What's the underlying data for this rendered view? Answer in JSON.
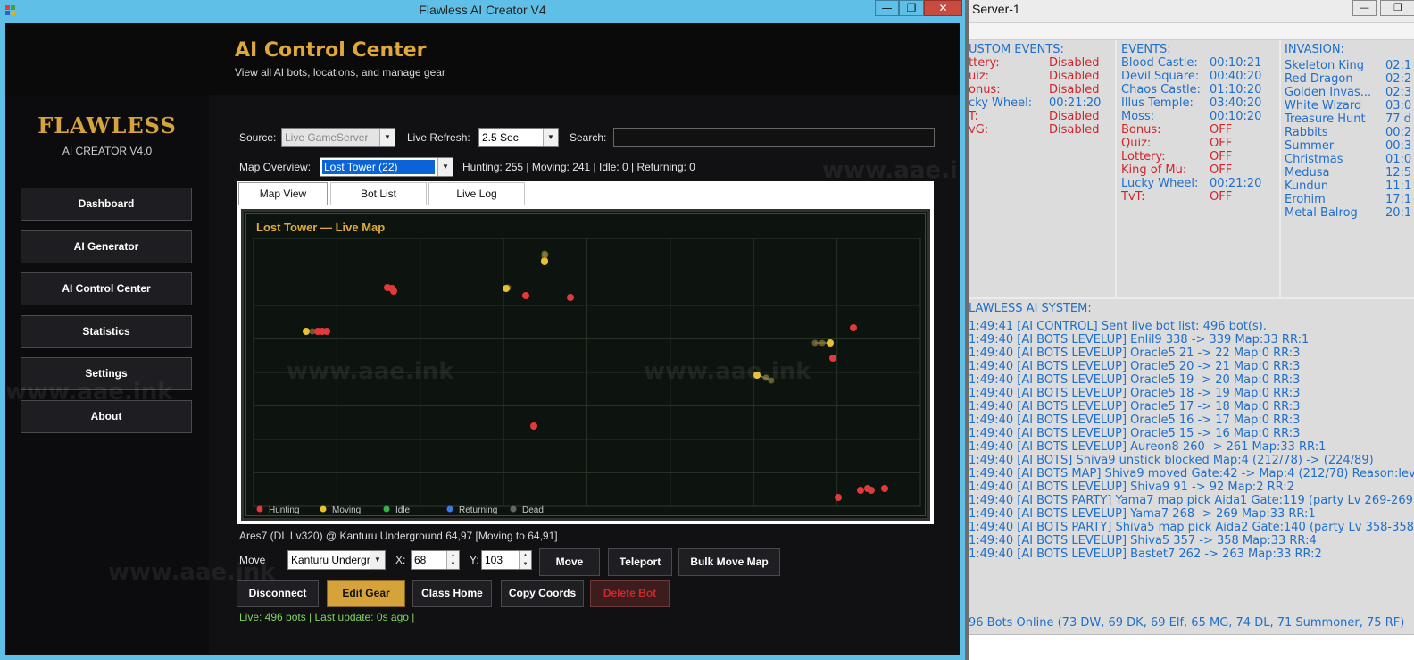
{
  "main_window": {
    "title": "Flawless AI Creator V4",
    "minimize": "—",
    "maximize": "❐",
    "close": "✕"
  },
  "sidebar": {
    "logo": "FLAWLESS",
    "logo_sub": "AI CREATOR V4.0",
    "items": [
      {
        "label": "Dashboard"
      },
      {
        "label": "AI Generator"
      },
      {
        "label": "AI Control Center"
      },
      {
        "label": "Statistics"
      },
      {
        "label": "Settings"
      },
      {
        "label": "About"
      }
    ]
  },
  "header": {
    "title": "AI Control Center",
    "subtitle": "View all AI bots, locations, and manage gear"
  },
  "filters": {
    "source_label": "Source:",
    "source_value": "Live GameServer",
    "refresh_label": "Live Refresh:",
    "refresh_value": "2.5 Sec",
    "search_label": "Search:",
    "map_label": "Map Overview:",
    "map_value": "Lost Tower (22)",
    "map_stats": "Hunting: 255 | Moving: 241 | Idle: 0 | Returning: 0"
  },
  "tabs": [
    {
      "label": "Map View"
    },
    {
      "label": "Bot List"
    },
    {
      "label": "Live Log"
    }
  ],
  "map": {
    "title": "Lost Tower — Live Map",
    "legend": [
      {
        "label": "Hunting",
        "color": "#e03a3a"
      },
      {
        "label": "Moving",
        "color": "#e8c030"
      },
      {
        "label": "Idle",
        "color": "#3ab04a"
      },
      {
        "label": "Returning",
        "color": "#3a7be0"
      },
      {
        "label": "Dead",
        "color": "#666666"
      }
    ],
    "colors": {
      "hunting": "#e03a3a",
      "moving": "#e8c030",
      "trail": "#8a7a3a"
    }
  },
  "selection": {
    "status": "Ares7 (DL Lv320) @ Kanturu Underground 64,97 [Moving to 64,91]",
    "move_label": "Move",
    "move_map": "Kanturu Undergr",
    "x_label": "X:",
    "x_value": "68",
    "y_label": "Y:",
    "y_value": "103"
  },
  "actions": {
    "move": "Move",
    "teleport": "Teleport",
    "bulk_move": "Bulk Move Map",
    "disconnect": "Disconnect",
    "edit_gear": "Edit Gear",
    "class_home": "Class Home",
    "copy_coords": "Copy Coords",
    "delete_bot": "Delete Bot"
  },
  "live_status": "Live: 496 bots | Last update: 0s ago |",
  "watermark": "www.aae.ink",
  "server_window": {
    "title": "Server-1",
    "custom_events": {
      "header": "USTOM EVENTS:",
      "rows": [
        {
          "name": "ttery:",
          "status": "Disabled",
          "kind": "red"
        },
        {
          "name": "uiz:",
          "status": "Disabled",
          "kind": "red"
        },
        {
          "name": "onus:",
          "status": "Disabled",
          "kind": "red"
        },
        {
          "name": "cky Wheel:",
          "status": "00:21:20",
          "kind": "blue"
        },
        {
          "name": "T:",
          "status": "Disabled",
          "kind": "red"
        },
        {
          "name": "vG:",
          "status": "Disabled",
          "kind": "red"
        }
      ]
    },
    "events": {
      "header": "EVENTS:",
      "rows": [
        {
          "name": "Blood Castle:",
          "value": "00:10:21",
          "kind": "blue"
        },
        {
          "name": "Devil Square:",
          "value": "00:40:20",
          "kind": "blue"
        },
        {
          "name": "Chaos Castle:",
          "value": "01:10:20",
          "kind": "blue"
        },
        {
          "name": "Illus Temple:",
          "value": "03:40:20",
          "kind": "blue"
        },
        {
          "name": "Moss:",
          "value": "00:10:20",
          "kind": "blue"
        },
        {
          "name": "Bonus:",
          "value": "OFF",
          "kind": "red"
        },
        {
          "name": "Quiz:",
          "value": "OFF",
          "kind": "red"
        },
        {
          "name": "Lottery:",
          "value": "OFF",
          "kind": "red"
        },
        {
          "name": "King of Mu:",
          "value": "OFF",
          "kind": "red"
        },
        {
          "name": "Lucky Wheel:",
          "value": "00:21:20",
          "kind": "blue"
        },
        {
          "name": "TvT:",
          "value": "OFF",
          "kind": "red"
        }
      ]
    },
    "invasion": {
      "header": "INVASION:",
      "rows": [
        {
          "name": "Skeleton King",
          "value": "02:1"
        },
        {
          "name": "Red Dragon",
          "value": "02:2"
        },
        {
          "name": "Golden Invas...",
          "value": "02:3"
        },
        {
          "name": "White Wizard",
          "value": "03:0"
        },
        {
          "name": "Treasure Hunt",
          "value": "77 d"
        },
        {
          "name": "Rabbits",
          "value": "00:2"
        },
        {
          "name": "Summer",
          "value": "00:3"
        },
        {
          "name": "Christmas",
          "value": "01:0"
        },
        {
          "name": "Medusa",
          "value": "12:5"
        },
        {
          "name": "Kundun",
          "value": "11:1"
        },
        {
          "name": "Erohim",
          "value": "17:1"
        },
        {
          "name": "Metal Balrog",
          "value": "20:1"
        }
      ]
    },
    "log_header": "LAWLESS AI SYSTEM:",
    "log": [
      "1:49:41 [AI CONTROL] Sent live bot list: 496 bot(s).",
      "1:49:40 [AI BOTS LEVELUP] Enlil9 338 -> 339 Map:33 RR:1",
      "1:49:40 [AI BOTS LEVELUP] Oracle5 21 -> 22 Map:0 RR:3",
      "1:49:40 [AI BOTS LEVELUP] Oracle5 20 -> 21 Map:0 RR:3",
      "1:49:40 [AI BOTS LEVELUP] Oracle5 19 -> 20 Map:0 RR:3",
      "1:49:40 [AI BOTS LEVELUP] Oracle5 18 -> 19 Map:0 RR:3",
      "1:49:40 [AI BOTS LEVELUP] Oracle5 17 -> 18 Map:0 RR:3",
      "1:49:40 [AI BOTS LEVELUP] Oracle5 16 -> 17 Map:0 RR:3",
      "1:49:40 [AI BOTS LEVELUP] Oracle5 15 -> 16 Map:0 RR:3",
      "1:49:40 [AI BOTS LEVELUP] Aureon8 260 -> 261 Map:33 RR:1",
      "1:49:40 [AI BOTS] Shiva9 unstick blocked Map:4 (212/78) -> (224/89)",
      "1:49:40 [AI BOTS MAP] Shiva9 moved Gate:42 -> Map:4 (212/78) Reason:lev",
      "1:49:40 [AI BOTS LEVELUP] Shiva9 91 -> 92 Map:2 RR:2",
      "1:49:40 [AI BOTS PARTY] Yama7 map pick Aida1 Gate:119 (party Lv 269-269",
      "1:49:40 [AI BOTS LEVELUP] Yama7 268 -> 269 Map:33 RR:1",
      "1:49:40 [AI BOTS PARTY] Shiva5 map pick Aida2 Gate:140 (party Lv 358-358",
      "1:49:40 [AI BOTS LEVELUP] Shiva5 357 -> 358 Map:33 RR:4",
      "1:49:40 [AI BOTS LEVELUP] Bastet7 262 -> 263 Map:33 RR:2"
    ],
    "footer": "96 Bots Online (73 DW, 69 DK, 69 Elf, 65 MG, 74 DL, 71 Summoner, 75 RF)"
  }
}
